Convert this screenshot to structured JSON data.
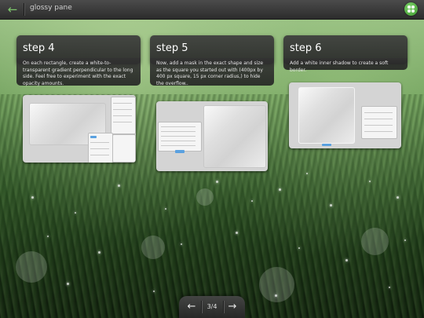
{
  "header": {
    "title": "glossy pane",
    "back_icon": "arrow-left-icon",
    "menu_icon": "grid-menu-icon",
    "accent": "#6fcf5d"
  },
  "steps": [
    {
      "heading": "step 4",
      "text": "On each rectangle, create a white-to-transparent gradient perpendicular to the long side. Feel free to experiment with the exact opacity amounts."
    },
    {
      "heading": "step 5",
      "text": "Now, add a mask in the exact shape and size as the square you started out with (400px by 400 px square, 15 px corner radius,) to hide the overflow.."
    },
    {
      "heading": "step 6",
      "text": "Add a white inner shadow to create a soft border."
    }
  ],
  "pager": {
    "label": "3/4",
    "prev_icon": "arrow-left-icon",
    "next_icon": "arrow-right-icon"
  }
}
